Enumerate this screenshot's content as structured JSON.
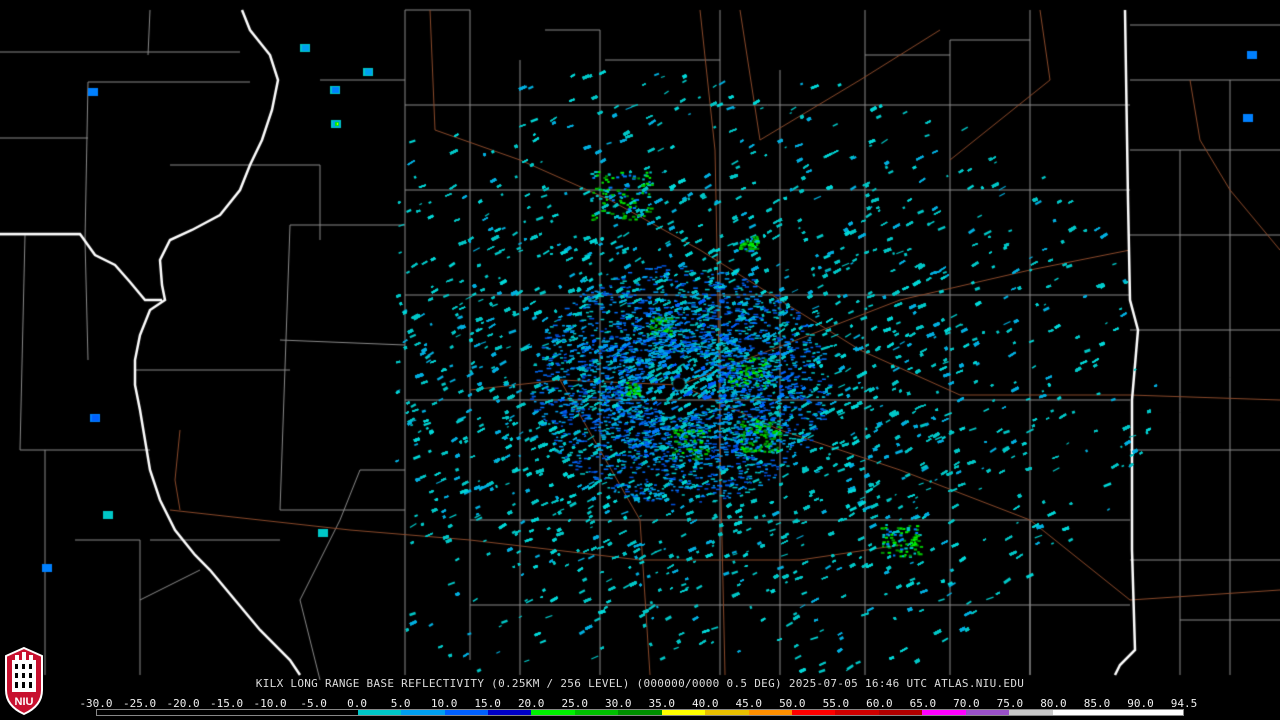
{
  "caption": "KILX LONG RANGE BASE REFLECTIVITY (0.25KM / 256 LEVEL) (000000/0000 0.5 DEG) 2025-07-05 16:46 UTC  ATLAS.NIU.EDU",
  "logo": {
    "text": "NIU",
    "colors": {
      "red": "#c8102e",
      "white": "#ffffff",
      "black": "#000000"
    }
  },
  "legend": {
    "labels": [
      "-30.0",
      "-25.0",
      "-20.0",
      "-15.0",
      "-10.0",
      "-5.0",
      "0.0",
      "5.0",
      "10.0",
      "15.0",
      "20.0",
      "25.0",
      "30.0",
      "35.0",
      "40.0",
      "45.0",
      "50.0",
      "55.0",
      "60.0",
      "65.0",
      "70.0",
      "75.0",
      "80.0",
      "85.0",
      "90.0",
      "94.5"
    ],
    "colors": [
      "#000000",
      "#000000",
      "#000000",
      "#000000",
      "#000000",
      "#000000",
      "#00c8c8",
      "#00a0f0",
      "#0060ff",
      "#0000c8",
      "#00f000",
      "#00c000",
      "#009000",
      "#ffff00",
      "#e8c000",
      "#ff9000",
      "#ff0000",
      "#d00000",
      "#b00000",
      "#ff00ff",
      "#9950c8",
      "#c8c8c8",
      "#ffffff",
      "#ffffff",
      "#ffffff"
    ]
  },
  "map": {
    "radar_site": "KILX",
    "colors": {
      "background": "#000000",
      "state_border": "#ffffff",
      "county_line": "#8a8a8a",
      "highway": "#8b4a2b",
      "radar_center": "#000000"
    }
  }
}
